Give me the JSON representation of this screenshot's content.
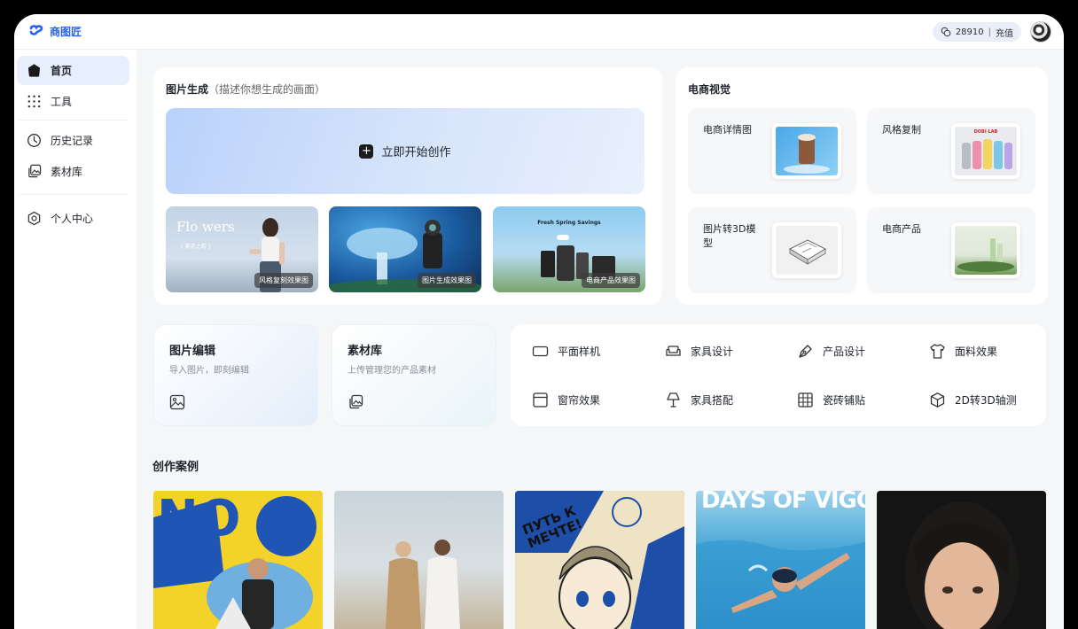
{
  "app": {
    "logo_text": "商图匠",
    "credits_value": "28910",
    "credits_action": "充值",
    "brand_color": "#2563eb"
  },
  "sidebar": {
    "items": [
      {
        "label": "首页",
        "icon": "home-icon",
        "active": true
      },
      {
        "label": "工具",
        "icon": "grid-icon"
      },
      {
        "label": "历史记录",
        "icon": "clock-icon"
      },
      {
        "label": "素材库",
        "icon": "gallery-icon"
      },
      {
        "label": "个人中心",
        "icon": "gear-icon"
      }
    ]
  },
  "generate": {
    "title": "图片生成",
    "subtitle": "（描述你想生成的画面）",
    "cta_label": "立即开始创作",
    "thumbs": [
      {
        "tag": "风格复刻效果图",
        "overlay_text": "Flo wers",
        "overlay_sub": "{ 繁花之韵 }"
      },
      {
        "tag": "图片生成效果图"
      },
      {
        "tag": "电商产品效果图",
        "overlay_text": "Fresh Spring Savings"
      }
    ]
  },
  "ecommerce": {
    "title": "电商视觉",
    "items": [
      {
        "label": "电商详情图"
      },
      {
        "label": "风格复制",
        "overlay_text": "DOBI LAB"
      },
      {
        "label": "图片转3D模型"
      },
      {
        "label": "电商产品"
      }
    ]
  },
  "quick_cards": [
    {
      "title": "图片编辑",
      "subtitle": "导入图片，即刻编辑",
      "icon": "image-icon"
    },
    {
      "title": "素材库",
      "subtitle": "上传管理您的产品素材",
      "icon": "gallery-icon"
    }
  ],
  "tools": [
    {
      "label": "平面样机",
      "icon": "rectangle-icon"
    },
    {
      "label": "家具设计",
      "icon": "sofa-icon"
    },
    {
      "label": "产品设计",
      "icon": "pen-icon"
    },
    {
      "label": "面料效果",
      "icon": "shirt-icon"
    },
    {
      "label": "窗帘效果",
      "icon": "window-icon"
    },
    {
      "label": "家具搭配",
      "icon": "lamp-icon"
    },
    {
      "label": "瓷砖铺贴",
      "icon": "tile-grid-icon"
    },
    {
      "label": "2D转3D轴测",
      "icon": "cube-icon"
    }
  ],
  "cases": {
    "title": "创作案例",
    "items": [
      {
        "name": "poster-no",
        "overlay_text": "NO"
      },
      {
        "name": "fashion-duo"
      },
      {
        "name": "anime-poster",
        "overlay_text": "ПУТЬ К МЕЧТЕ!"
      },
      {
        "name": "swimmer",
        "overlay_text": "DAYS OF VIGOR"
      },
      {
        "name": "portrait"
      }
    ]
  }
}
